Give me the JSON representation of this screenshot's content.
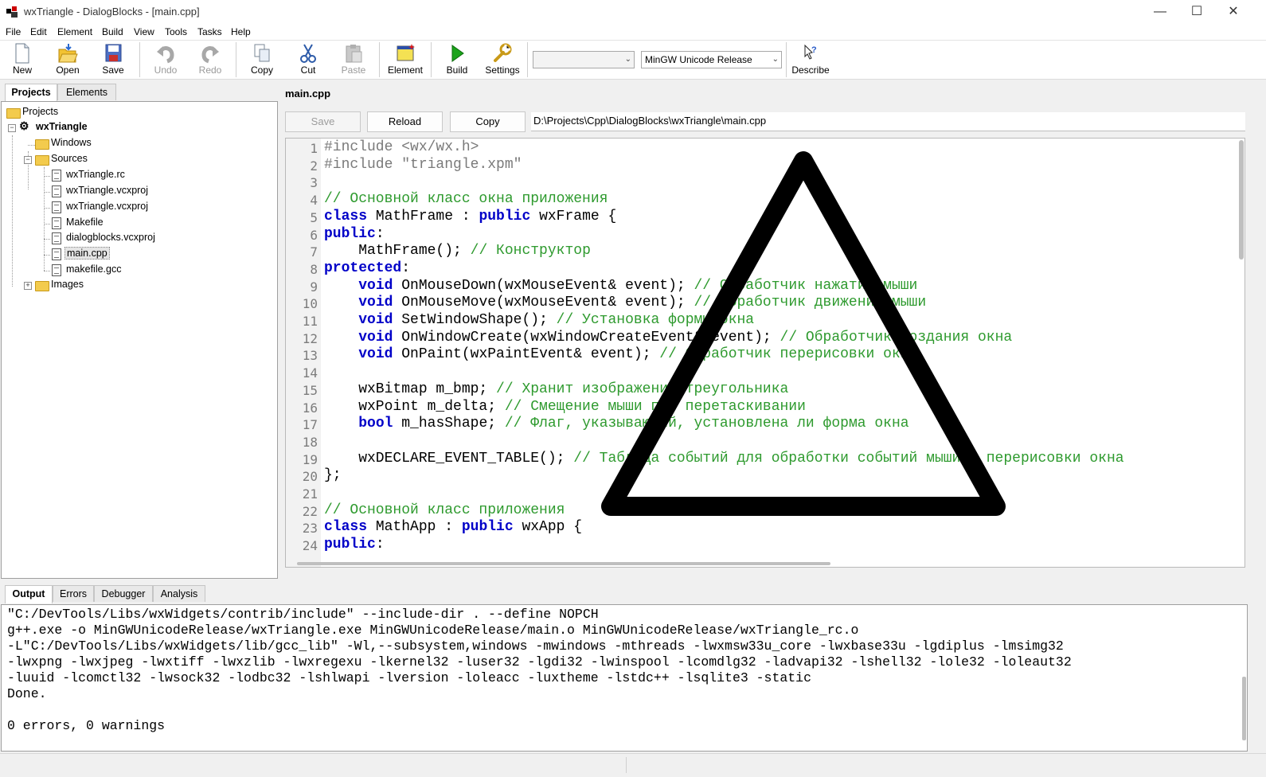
{
  "window": {
    "title": "wxTriangle - DialogBlocks - [main.cpp]"
  },
  "menu": [
    "File",
    "Edit",
    "Element",
    "Build",
    "View",
    "Tools",
    "Tasks",
    "Help"
  ],
  "toolbar": {
    "new": "New",
    "open": "Open",
    "save": "Save",
    "undo": "Undo",
    "redo": "Redo",
    "copy": "Copy",
    "cut": "Cut",
    "paste": "Paste",
    "element": "Element",
    "build": "Build",
    "settings": "Settings",
    "describe": "Describe",
    "config_combo": "",
    "build_config": "MinGW Unicode Release"
  },
  "left_tabs": {
    "projects": "Projects",
    "elements": "Elements"
  },
  "tree": {
    "root": "Projects",
    "project": "wxTriangle",
    "windows": "Windows",
    "sources": "Sources",
    "files": [
      "wxTriangle.rc",
      "wxTriangle.vcxproj",
      "wxTriangle.vcxproj",
      "Makefile",
      "dialogblocks.vcxproj",
      "main.cpp",
      "makefile.gcc"
    ],
    "images": "Images"
  },
  "editor": {
    "file_title": "main.cpp",
    "save_label": "Save",
    "reload_label": "Reload",
    "copy_label": "Copy",
    "path": "D:\\Projects\\Cpp\\DialogBlocks\\wxTriangle\\main.cpp",
    "line_numbers": [
      "1",
      "2",
      "3",
      "4",
      "5",
      "6",
      "7",
      "8",
      "9",
      "10",
      "11",
      "12",
      "13",
      "14",
      "15",
      "16",
      "17",
      "18",
      "19",
      "20",
      "21",
      "22",
      "23",
      "24"
    ],
    "lines": [
      "#include <wx/wx.h>",
      "#include \"triangle.xpm\"",
      "",
      "// Основной класс окна приложения",
      "class MathFrame : public wxFrame {",
      "public:",
      "    MathFrame(); // Конструктор",
      "protected:",
      "    void OnMouseDown(wxMouseEvent& event); // Обработчик нажатия мыши",
      "    void OnMouseMove(wxMouseEvent& event); // Обработчик движения мыши",
      "    void SetWindowShape(); // Установка формы окна",
      "    void OnWindowCreate(wxWindowCreateEvent& event); // Обработчик создания окна",
      "    void OnPaint(wxPaintEvent& event); // Обработчик перерисовки окна",
      "",
      "    wxBitmap m_bmp; // Хранит изображение треугольника",
      "    wxPoint m_delta; // Смещение мыши при перетаскивании",
      "    bool m_hasShape; // Флаг, указывающий, установлена ли форма окна",
      "",
      "    wxDECLARE_EVENT_TABLE(); // Таблица событий для обработки событий мыши и перерисовки окна",
      "};",
      "",
      "// Основной класс приложения",
      "class MathApp : public wxApp {",
      "public:"
    ]
  },
  "output_tabs": [
    "Output",
    "Errors",
    "Debugger",
    "Analysis"
  ],
  "output_lines": [
    "\"C:/DevTools/Libs/wxWidgets/contrib/include\" --include-dir . --define NOPCH",
    "g++.exe -o MinGWUnicodeRelease/wxTriangle.exe MinGWUnicodeRelease/main.o MinGWUnicodeRelease/wxTriangle_rc.o",
    "-L\"C:/DevTools/Libs/wxWidgets/lib/gcc_lib\" -Wl,--subsystem,windows -mwindows -mthreads -lwxmsw33u_core -lwxbase33u -lgdiplus -lmsimg32",
    "-lwxpng -lwxjpeg -lwxtiff -lwxzlib -lwxregexu -lkernel32 -luser32 -lgdi32 -lwinspool -lcomdlg32 -ladvapi32 -lshell32 -lole32 -loleaut32",
    "-luuid -lcomctl32 -lwsock32 -lodbc32 -lshlwapi -lversion -loleacc -luxtheme -lstdc++ -lsqlite3 -static",
    "Done.",
    "",
    "0 errors, 0 warnings"
  ],
  "colors": {
    "keyword": "#0000c8",
    "comment": "#2e9a2e",
    "preprocessor": "#7a7a7a"
  }
}
